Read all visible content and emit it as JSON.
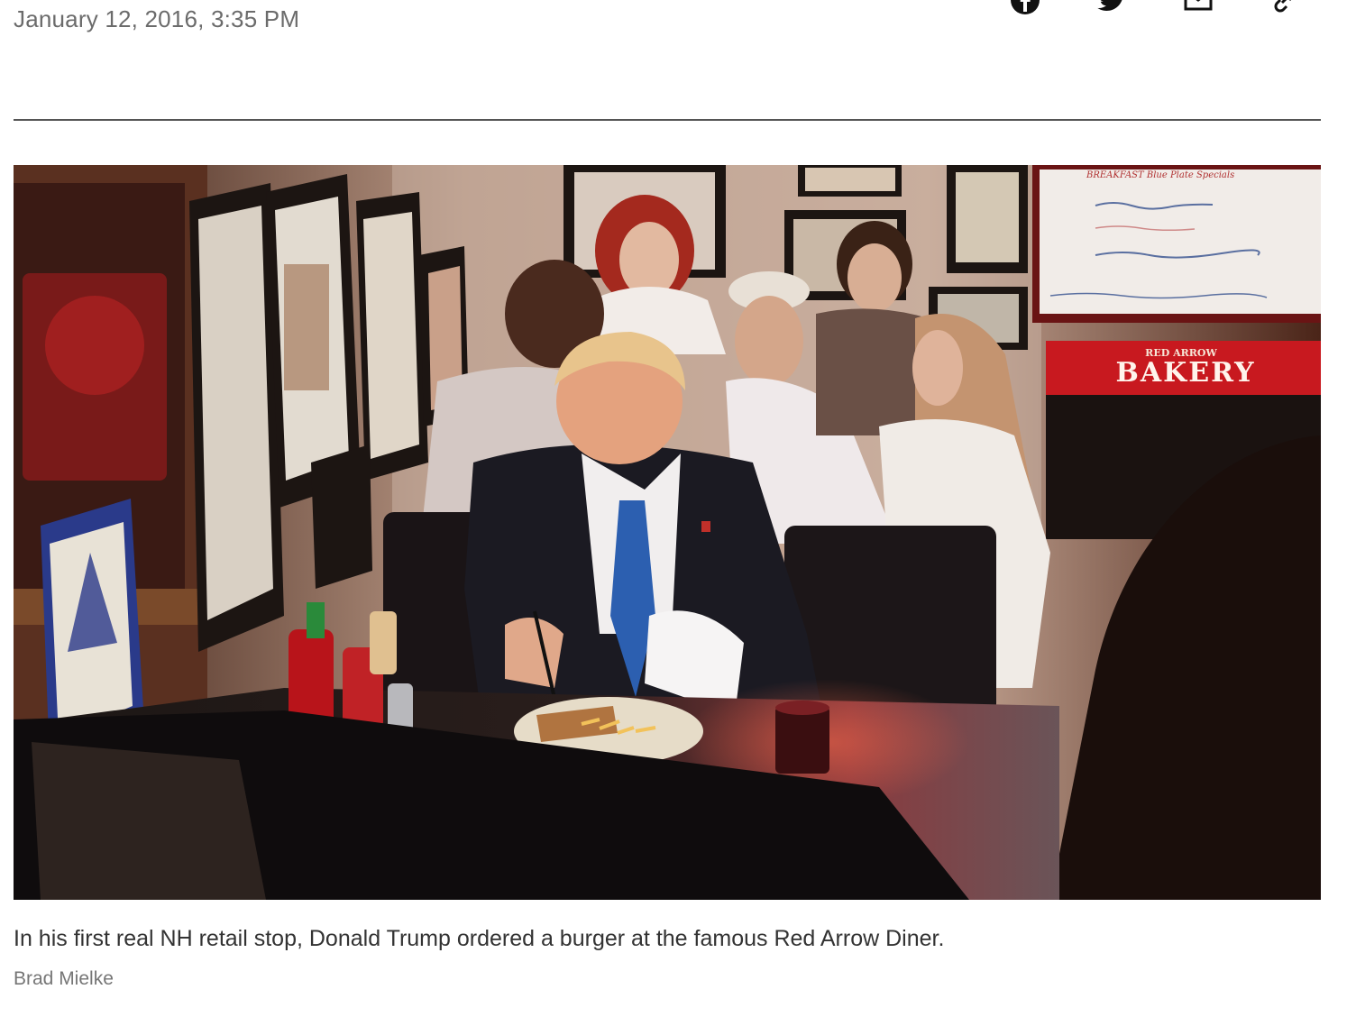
{
  "article": {
    "date": "January 12, 2016, 3:35 PM",
    "caption": "In his first real NH retail stop, Donald Trump ordered a burger at the famous Red Arrow Diner.",
    "credit": "Brad Mielke"
  },
  "share": [
    {
      "icon": "facebook-icon"
    },
    {
      "icon": "twitter-icon"
    },
    {
      "icon": "email-icon"
    },
    {
      "icon": "link-icon"
    }
  ],
  "photo": {
    "sign_small": "RED ARROW",
    "sign_large": "BAKERY",
    "board_title": "BREAKFAST Blue Plate Specials"
  },
  "colors": {
    "date_text": "#6b6b6b",
    "caption_text": "#333333",
    "credit_text": "#767676",
    "divider": "#555555",
    "sign_red": "#c8191f"
  }
}
